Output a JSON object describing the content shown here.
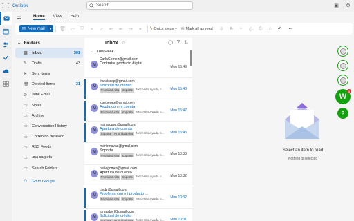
{
  "app": {
    "title": "Outlook"
  },
  "search": {
    "placeholder": "Search"
  },
  "ribbon": {
    "tabs": [
      "Home",
      "View",
      "Help"
    ],
    "new_mail": "New mail",
    "quick_steps": "Quick steps",
    "mark_all_read": "Mark all as read"
  },
  "folders": {
    "header": "Folders",
    "items": [
      {
        "name": "Inbox",
        "count": "301",
        "icon": "inbox-icon"
      },
      {
        "name": "Drafts",
        "count": "43",
        "icon": "pencil-icon"
      },
      {
        "name": "Sent Items",
        "count": "",
        "icon": "send-icon"
      },
      {
        "name": "Deleted Items",
        "count": "31",
        "icon": "trash-icon"
      },
      {
        "name": "Junk Email",
        "count": "",
        "icon": "junk-icon"
      },
      {
        "name": "Notes",
        "count": "",
        "icon": "notes-icon"
      },
      {
        "name": "Archive",
        "count": "",
        "icon": "archive-icon"
      },
      {
        "name": "Conversation History",
        "count": "",
        "icon": "folder-icon"
      },
      {
        "name": "Correo no deseado",
        "count": "",
        "icon": "folder-icon"
      },
      {
        "name": "RSS Feeds",
        "count": "",
        "icon": "folder-icon"
      },
      {
        "name": "una carpeta",
        "count": "",
        "icon": "folder-icon"
      },
      {
        "name": "Search Folders",
        "count": "",
        "icon": "folder-icon"
      }
    ],
    "go_to_groups": "Go to Groups"
  },
  "message_list": {
    "title": "Inbox",
    "group": "This week",
    "messages": [
      {
        "avatar": "M",
        "from": "CarlaGomez@gmail.com",
        "subject": "Contratar producto digital",
        "time": "Mon 15:49",
        "unread": false,
        "tags": [],
        "preview": ""
      },
      {
        "avatar": "M",
        "from": "franciscop@gmail.com",
        "subject": "Solicitud de crédito",
        "time": "Mon 15:48",
        "unread": true,
        "tags": [
          "Prioridad Alta",
          "Soporte"
        ],
        "preview": "Necesito ayuda p..."
      },
      {
        "avatar": "M",
        "from": "josepenez@gmail.com",
        "subject": "Ayuda con mi cuenta",
        "time": "Mon 15:47",
        "unread": true,
        "tags": [
          "Prioridad Alta",
          "Soporte"
        ],
        "preview": "Necesito ayuda p..."
      },
      {
        "avatar": "M",
        "from": "martalopez@gmail.com",
        "subject": "Apertura de cuenta",
        "time": "Mon 15:45",
        "unread": true,
        "tags": [
          "Soporte",
          "Prioridad Alta"
        ],
        "preview": "Necesito ayuda p..."
      },
      {
        "avatar": "M",
        "from": "martinnavas@gmail.com",
        "subject": "Soporte",
        "time": "Mon 10:33",
        "unread": false,
        "tags": [
          "Prioridad Alta",
          "Soporte"
        ],
        "preview": "Necesito ayuda p..."
      },
      {
        "avatar": "M",
        "from": "beriogomes@gmail.com",
        "subject": "Apertura de cuenta",
        "time": "Mon 10:32",
        "unread": false,
        "tags": [
          "Prioridad Alta",
          "Soporte"
        ],
        "preview": "Necesito ayuda p..."
      },
      {
        "avatar": "M",
        "from": "cindy@gmail.com",
        "subject": "Problema con mi producto ...",
        "time": "Mon 10:32",
        "unread": true,
        "tags": [
          "Prioridad Alta",
          "Soporte"
        ],
        "preview": "Necesito ayuda p..."
      },
      {
        "avatar": "M",
        "from": "tomasberl@gmail.com",
        "subject": "Solicitud de crédito",
        "time": "Mon 10:31",
        "unread": true,
        "tags": [
          "Soporte",
          "Prioridad Alta"
        ],
        "preview": "Necesito ayuda p..."
      }
    ]
  },
  "reading_pane": {
    "title": "Select an item to read",
    "subtitle": "Nothing is selected"
  },
  "addins": {
    "w_label": "W",
    "w_badge": "1",
    "q_label": "?"
  },
  "colors": {
    "accent": "#0f6cbd",
    "addin_green": "#13a10e"
  }
}
